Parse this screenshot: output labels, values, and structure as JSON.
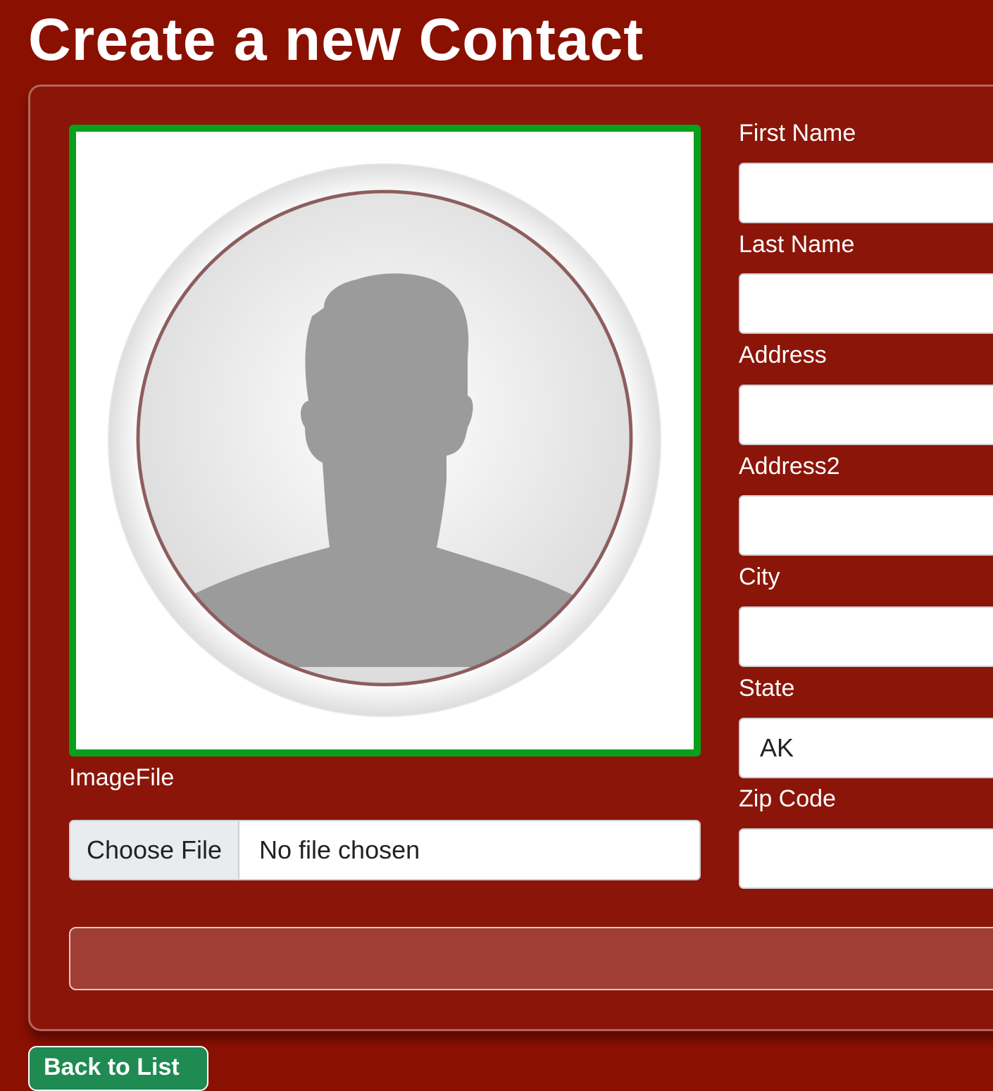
{
  "page": {
    "title": "Create a new Contact"
  },
  "form": {
    "image_label": "ImageFile",
    "file_button_label": "Choose File",
    "file_status": "No file chosen",
    "fields": [
      {
        "label": "First Name",
        "value": ""
      },
      {
        "label": "Last Name",
        "value": ""
      },
      {
        "label": "Address",
        "value": ""
      },
      {
        "label": "Address2",
        "value": ""
      },
      {
        "label": "City",
        "value": ""
      },
      {
        "label": "State",
        "value": "AK"
      },
      {
        "label": "Zip Code",
        "value": ""
      }
    ],
    "submit_label": ""
  },
  "nav": {
    "back_label": "Back to List"
  },
  "colors": {
    "background": "#8a1002",
    "image_border": "#06a11c",
    "input_background": "#ffffff",
    "submit_background": "#a03e36",
    "back_button": "#1f8a52"
  },
  "icons": {
    "avatar": "user-placeholder-avatar-icon"
  }
}
